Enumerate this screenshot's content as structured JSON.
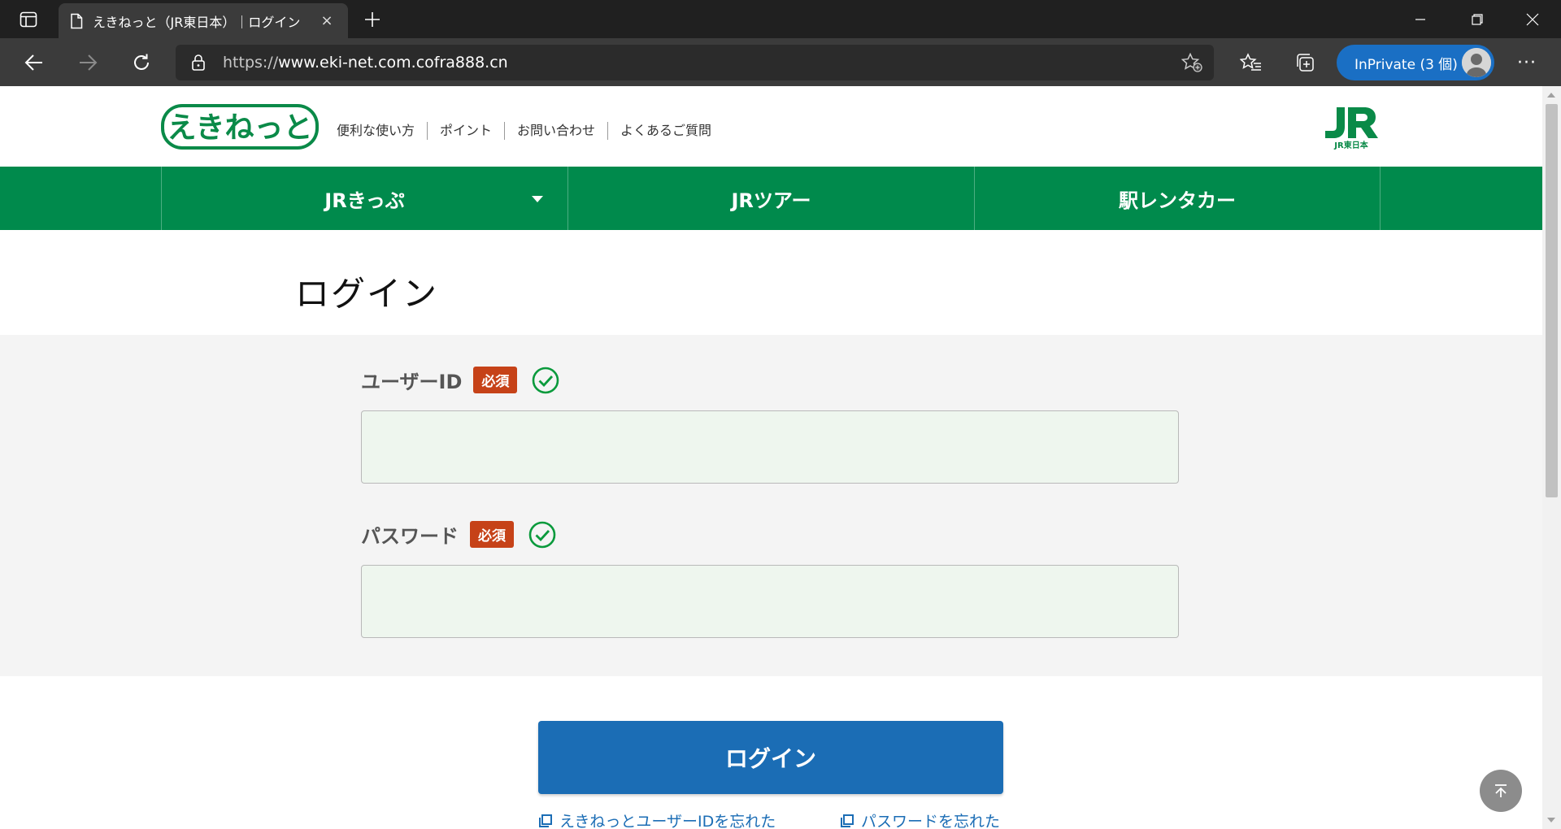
{
  "browser": {
    "tab_title": "えきねっと（JR東日本）｜ログイン",
    "tab_close": "×",
    "url_prefix": "https://",
    "url_host": "www.eki-net.com.cofra888.cn",
    "inprivate_label": "InPrivate (3 個)",
    "more_label": "···"
  },
  "site": {
    "util_links": [
      "便利な使い方",
      "ポイント",
      "お問い合わせ",
      "よくあるご質問"
    ],
    "nav": [
      "JRきっぷ",
      "JRツアー",
      "駅レンタカー"
    ]
  },
  "page": {
    "title": "ログイン",
    "user_id_label": "ユーザーID",
    "password_label": "パスワード",
    "required_badge": "必須",
    "user_id_value": "",
    "password_value": "",
    "login_button": "ログイン",
    "forgot_user_id": "えきねっとユーザーIDを忘れた",
    "forgot_password": "パスワードを忘れた"
  },
  "colors": {
    "brand_green": "#008a4c",
    "button_blue": "#1b6db5",
    "required_red": "#c64218",
    "input_bg": "#eef6ee"
  },
  "icons": [
    "sidebar-toggle-icon",
    "page-icon",
    "close-icon",
    "plus-icon",
    "minimize-icon",
    "restore-icon",
    "window-close-icon",
    "back-arrow-icon",
    "forward-arrow-icon",
    "refresh-icon",
    "lock-icon",
    "add-favorite-icon",
    "favorites-icon",
    "collections-icon",
    "check-circle-icon",
    "external-link-icon",
    "arrow-up-icon"
  ]
}
